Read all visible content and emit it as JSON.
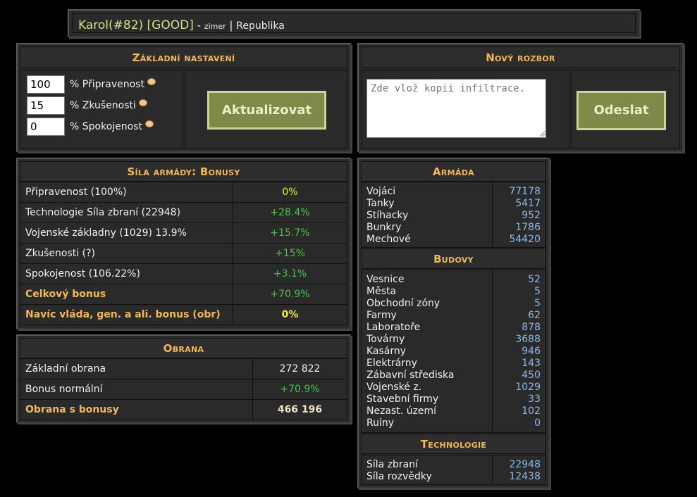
{
  "header": {
    "name": "Karol(#82) [GOOD]",
    "separator": " - ",
    "user": "zimer",
    "pipe": " | ",
    "government": "Republika"
  },
  "settings": {
    "title": "Základní nastavení",
    "fields": [
      {
        "value": "100",
        "label": "% Připravenost"
      },
      {
        "value": "15",
        "label": "% Zkušenosti"
      },
      {
        "value": "0",
        "label": "% Spokojenost"
      }
    ],
    "button": "Aktualizovat"
  },
  "analysis": {
    "title": "Nový rozbor",
    "placeholder": "Zde vlož kopii infiltrace.",
    "button": "Odeslat"
  },
  "bonus": {
    "title": "Síla armády: Bonusy",
    "rows": [
      {
        "label": "Připravenost (100%)",
        "value": "0%"
      },
      {
        "label": "Technologie Síla zbraní (22948)",
        "value": "+28.4%"
      },
      {
        "label": "Vojenské základny (1029) 13.9%",
        "value": "+15.7%"
      },
      {
        "label": "Zkušenosti (?)",
        "value": "+15%"
      },
      {
        "label": "Spokojenost (106.22%)",
        "value": "+3.1%"
      },
      {
        "label": "Celkový bonus",
        "value": "+70.9%"
      },
      {
        "label": "Navíc vláda, gen. a ali. bonus (obr)",
        "value": "0%"
      }
    ]
  },
  "defense": {
    "title": "Obrana",
    "rows": [
      {
        "label": "Základní obrana",
        "value": "272 822"
      },
      {
        "label": "Bonus normální",
        "value": "+70.9%"
      },
      {
        "label": "Obrana s bonusy",
        "value": "466 196"
      }
    ]
  },
  "army": {
    "title": "Armáda",
    "items": [
      {
        "label": "Vojáci",
        "value": "77178"
      },
      {
        "label": "Tanky",
        "value": "5417"
      },
      {
        "label": "Stíhacky",
        "value": "952"
      },
      {
        "label": "Bunkry",
        "value": "1786"
      },
      {
        "label": "Mechové",
        "value": "54420"
      }
    ]
  },
  "buildings": {
    "title": "Budovy",
    "items": [
      {
        "label": "Vesnice",
        "value": "52"
      },
      {
        "label": "Města",
        "value": "5"
      },
      {
        "label": "Obchodní zóny",
        "value": "5"
      },
      {
        "label": "Farmy",
        "value": "62"
      },
      {
        "label": "Laboratoře",
        "value": "878"
      },
      {
        "label": "Továrny",
        "value": "3688"
      },
      {
        "label": "Kasárny",
        "value": "946"
      },
      {
        "label": "Elektrárny",
        "value": "143"
      },
      {
        "label": "Zábavní střediska",
        "value": "450"
      },
      {
        "label": "Vojenské z.",
        "value": "1029"
      },
      {
        "label": "Stavební firmy",
        "value": "33"
      },
      {
        "label": "Nezast. území",
        "value": "102"
      },
      {
        "label": "Ruiny",
        "value": "0"
      }
    ]
  },
  "technology": {
    "title": "Technologie",
    "items": [
      {
        "label": "Síla zbraní",
        "value": "22948"
      },
      {
        "label": "Síla rozvědky",
        "value": "12438"
      }
    ]
  }
}
